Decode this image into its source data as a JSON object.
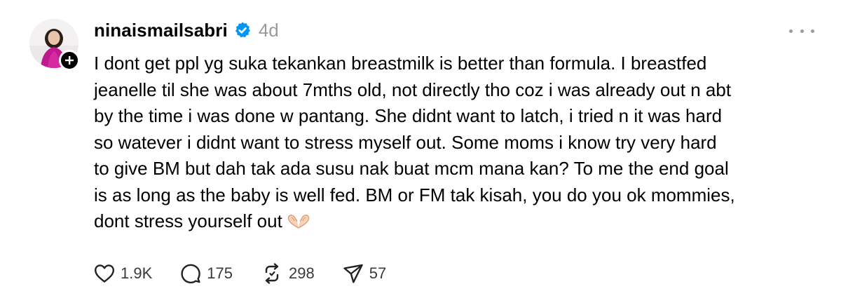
{
  "post": {
    "author": {
      "username": "ninaismailsabri",
      "verified": true,
      "timestamp": "4d"
    },
    "body_lines": [
      "I dont get ppl yg suka tekankan breastmilk is better than formula. I breastfed",
      "jeanelle til she was about 7mths old, not directly tho coz i was already out n abt",
      "by the time i was done w pantang. She didnt want to latch, i tried n it was hard",
      "so watever i didnt want to stress myself out. Some moms i know try very hard",
      "to give BM but dah tak ada susu nak buat mcm mana kan? To me the end goal",
      "is as long as the baby is well fed. BM or FM tak kisah, you do you ok mommies,",
      "dont stress yourself out"
    ],
    "trailing_emoji": "heart-hands-emoji",
    "actions": {
      "likes": "1.9K",
      "replies": "175",
      "reposts": "298",
      "shares": "57"
    },
    "icons": {
      "verified": "verified-badge-icon",
      "follow": "plus-icon",
      "more": "more-options-icon",
      "like": "heart-icon",
      "reply": "comment-bubble-icon",
      "repost": "repost-icon",
      "share": "send-icon"
    },
    "colors": {
      "verified": "#0095f6",
      "muted": "#9a9a9a",
      "text": "#000000"
    }
  }
}
